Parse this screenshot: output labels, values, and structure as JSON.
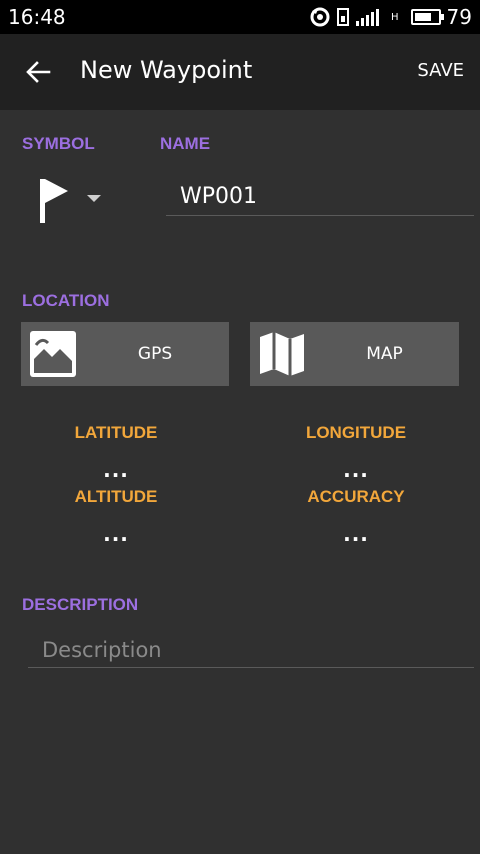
{
  "status_bar": {
    "time": "16:48",
    "battery_level": "79",
    "battery_fraction": 0.79,
    "network_type": "H",
    "icons": [
      "sync-icon",
      "sim-icon",
      "signal-icon",
      "battery-icon"
    ]
  },
  "toolbar": {
    "title": "New Waypoint",
    "save_label": "SAVE",
    "back_icon": "back-arrow-icon"
  },
  "form": {
    "symbol_label": "SYMBOL",
    "name_label": "NAME",
    "symbol_icon": "flag-icon",
    "name_value": "WP001",
    "location_label": "LOCATION",
    "gps_button_label": "GPS",
    "map_button_label": "MAP",
    "latitude_label": "LATITUDE",
    "latitude_value": "...",
    "longitude_label": "LONGITUDE",
    "longitude_value": "...",
    "altitude_label": "ALTITUDE",
    "altitude_value": "...",
    "accuracy_label": "ACCURACY",
    "accuracy_value": "...",
    "description_label": "DESCRIPTION",
    "description_placeholder": "Description",
    "description_value": ""
  },
  "colors": {
    "background": "#303030",
    "toolbar": "#212121",
    "section_label": "#9c6fe0",
    "readout_label": "#f2a73b",
    "button_bg": "#595959"
  }
}
